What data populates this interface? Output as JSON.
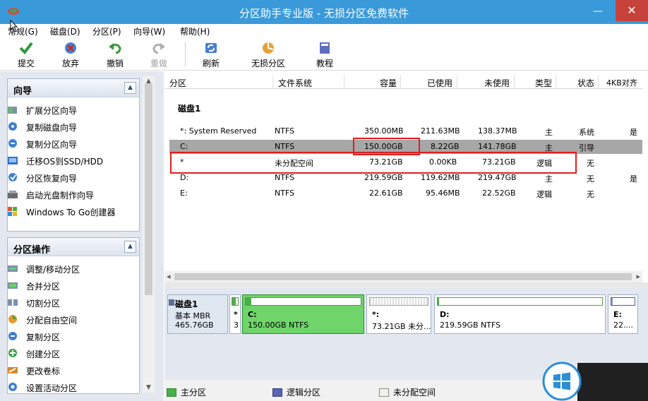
{
  "window": {
    "title": "分区助手专业版 - 无损分区免费软件",
    "minimize": "—",
    "close": "✕"
  },
  "menu": [
    "常规(G)",
    "磁盘(D)",
    "分区(P)",
    "向导(W)",
    "帮助(H)"
  ],
  "toolbar": {
    "submit": "提交",
    "discard": "放弃",
    "undo": "撤销",
    "redo": "重做",
    "refresh": "刷新",
    "lossless": "无损分区",
    "tutorial": "教程"
  },
  "wizard_panel": {
    "title": "向导",
    "items": [
      "扩展分区向导",
      "复制磁盘向导",
      "复制分区向导",
      "迁移OS到SSD/HDD",
      "分区恢复向导",
      "启动光盘制作向导",
      "Windows To Go创建器"
    ]
  },
  "ops_panel": {
    "title": "分区操作",
    "items": [
      "调整/移动分区",
      "合并分区",
      "切割分区",
      "分配自由空间",
      "复制分区",
      "创建分区",
      "更改卷标",
      "设置活动分区"
    ]
  },
  "columns": [
    "分区",
    "文件系统",
    "容量",
    "已使用",
    "未使用",
    "类型",
    "状态",
    "4KB对齐"
  ],
  "disk1": {
    "label": "磁盘1",
    "partitions": [
      {
        "name": "*: System Reserved",
        "fs": "NTFS",
        "capacity": "350.00MB",
        "used": "211.63MB",
        "unused": "138.37MB",
        "type": "主",
        "status": "系统",
        "align": "是"
      },
      {
        "name": "C:",
        "fs": "NTFS",
        "capacity": "150.00GB",
        "used": "8.22GB",
        "unused": "141.78GB",
        "type": "主",
        "status": "引导",
        "align": ""
      },
      {
        "name": "*",
        "fs": "未分配空间",
        "capacity": "73.21GB",
        "used": "0.00KB",
        "unused": "73.21GB",
        "type": "逻辑",
        "status": "无",
        "align": ""
      },
      {
        "name": "D:",
        "fs": "NTFS",
        "capacity": "219.59GB",
        "used": "119.62MB",
        "unused": "219.47GB",
        "type": "主",
        "status": "无",
        "align": "是"
      },
      {
        "name": "E:",
        "fs": "NTFS",
        "capacity": "22.61GB",
        "used": "95.46MB",
        "unused": "22.52GB",
        "type": "逻辑",
        "status": "无",
        "align": ""
      }
    ]
  },
  "diskmap": {
    "disk_name": "磁盘1",
    "disk_type": "基本 MBR",
    "disk_size": "465.76GB",
    "blocks": [
      {
        "l1": "*",
        "l2": "3",
        "fill": 0.6
      },
      {
        "l1": "C:",
        "l2": "150.00GB NTFS",
        "fill": 0.05
      },
      {
        "l1": "*:",
        "l2": "73.21GB 未分...",
        "fill": 0
      },
      {
        "l1": "D:",
        "l2": "219.59GB NTFS",
        "fill": 0.01
      },
      {
        "l1": "E:",
        "l2": "22....",
        "fill": 0.05
      }
    ]
  },
  "legend": {
    "primary": "主分区",
    "logical": "逻辑分区",
    "unallocated": "未分配空间"
  },
  "colors": {
    "titlebar": "#3a9ad9",
    "primary": "#48b04a",
    "logical": "#5a64b8",
    "highlight": "#e21d1d"
  }
}
